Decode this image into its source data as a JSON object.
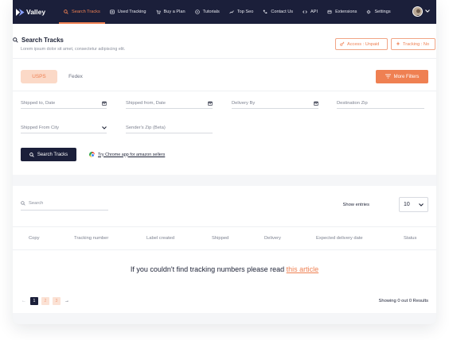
{
  "app": {
    "name": "Valley"
  },
  "nav": {
    "items": [
      {
        "label": "Search Tracks",
        "icon": "search-icon",
        "active": true
      },
      {
        "label": "Used Tracking",
        "icon": "list-icon",
        "active": false
      },
      {
        "label": "Buy a Plan",
        "icon": "cart-icon",
        "active": false
      },
      {
        "label": "Tutorials",
        "icon": "play-icon",
        "active": false
      },
      {
        "label": "Top Seo",
        "icon": "chart-icon",
        "active": false
      },
      {
        "label": "Contact Us",
        "icon": "phone-icon",
        "active": false
      },
      {
        "label": "API",
        "icon": "code-icon",
        "active": false
      },
      {
        "label": "Extensions",
        "icon": "puzzle-icon",
        "active": false
      },
      {
        "label": "Settings",
        "icon": "gear-icon",
        "active": false
      }
    ]
  },
  "header": {
    "title": "Search Tracks",
    "subtitle": "Lorem ipsum dolor sit amet, consectetur adipiscing elit.",
    "access_label": "Access : Unpaid",
    "tracking_label": "Tracking : No"
  },
  "filters": {
    "tabs": [
      {
        "label": "USPS",
        "active": true
      },
      {
        "label": "Fedex",
        "active": false
      }
    ],
    "more_filters": "More Filters",
    "fields": {
      "shipped_to": "Shipped to, Date",
      "shipped_from": "Shipped from, Date",
      "delivery_by": "Delivery By",
      "destination_zip": "Destination Zip",
      "shipped_from_city": "Shipped From City",
      "senders_zip": "Sender's Zip (Beta)"
    },
    "search_button": "Search Tracks",
    "chrome_link": "Try Chrome app for amazon sellers"
  },
  "results": {
    "search_placeholder": "Search",
    "show_entries_label": "Show entries",
    "entries_value": "10",
    "columns": [
      "Copy",
      "Tracking number",
      "Label created",
      "Shipped",
      "Delivery",
      "Expected delivery date",
      "Status"
    ],
    "empty_message": "If you couldn't find tracking numbers please read",
    "empty_link": "this article",
    "pages": [
      "1",
      "2",
      "3"
    ],
    "prev_arrow": "←",
    "next_arrow": "→",
    "showing": "Showing 0 out 0 Results"
  },
  "colors": {
    "accent": "#ef8052",
    "nav_bg": "#1b1f3a",
    "accent_light": "#fbd9c7"
  }
}
